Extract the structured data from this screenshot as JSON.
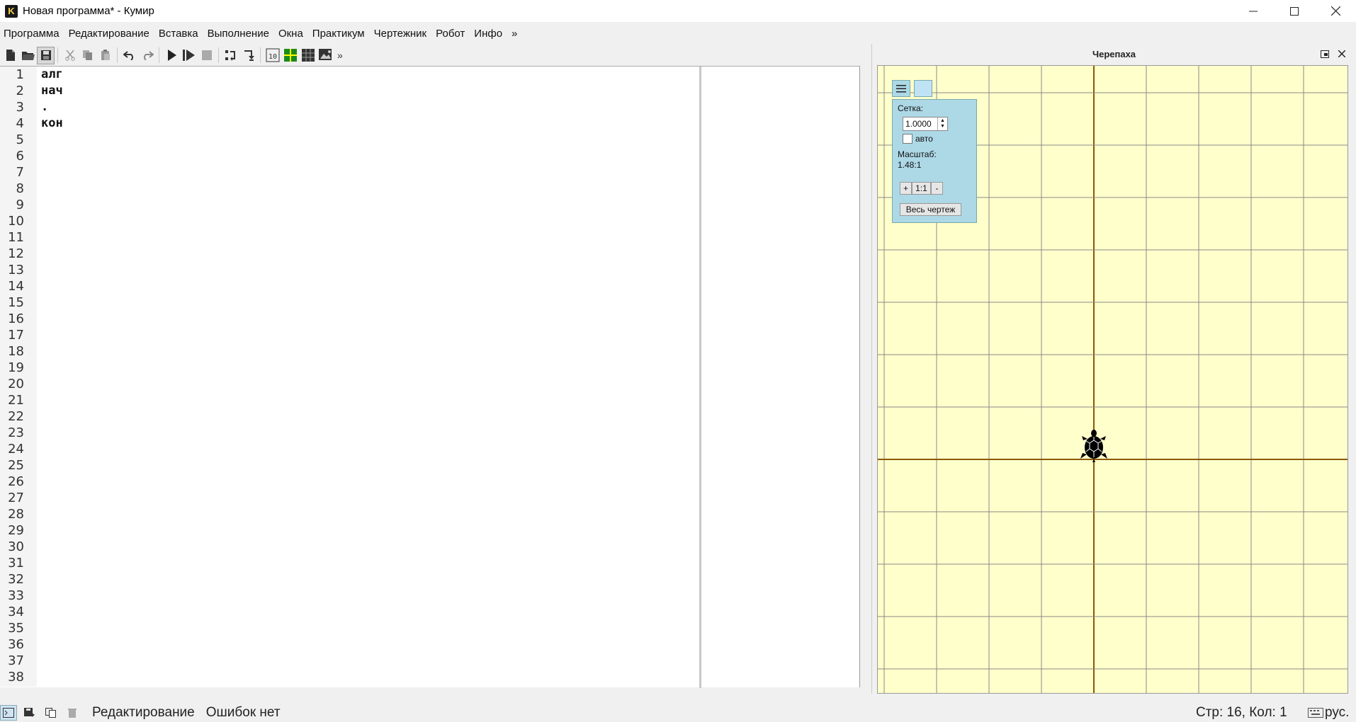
{
  "window": {
    "title": "Новая программа* - Кумир",
    "app_icon_letter": "K",
    "minimize_icon": "minimize-icon",
    "maximize_icon": "maximize-icon",
    "close_icon": "close-icon"
  },
  "menu": {
    "items": [
      "Программа",
      "Редактирование",
      "Вставка",
      "Выполнение",
      "Окна",
      "Практикум",
      "Чертежник",
      "Робот",
      "Инфо"
    ],
    "more": "»"
  },
  "toolbar": {
    "more": "»",
    "buttons": [
      "new-file-icon",
      "open-file-icon",
      "save-icon",
      "cut-icon",
      "copy-icon",
      "paste-icon",
      "undo-icon",
      "redo-icon",
      "run-icon",
      "run-step-icon",
      "stop-icon",
      "step-over-icon",
      "step-into-icon",
      "variables-icon",
      "turtle-grid-icon",
      "robot-field-icon",
      "drawer-icon"
    ]
  },
  "editor": {
    "line_numbers": [
      "1",
      "2",
      "3",
      "4",
      "5",
      "6",
      "7",
      "8",
      "9",
      "10",
      "11",
      "12",
      "13",
      "14",
      "15",
      "16",
      "17",
      "18",
      "19",
      "20",
      "21",
      "22",
      "23",
      "24",
      "25",
      "26",
      "27",
      "28",
      "29",
      "30",
      "31",
      "32",
      "33",
      "34",
      "35",
      "36",
      "37",
      "38"
    ],
    "code_lines": [
      "алг",
      "нач",
      ".",
      "кон"
    ]
  },
  "turtle": {
    "title": "Черепаха",
    "grid_label": "Сетка:",
    "grid_value": "1.0000",
    "auto_label": "авто",
    "auto_checked": false,
    "scale_label": "Масштаб:",
    "scale_value": "1.48:1",
    "zoom_in": "+",
    "zoom_reset": "1:1",
    "zoom_out": "-",
    "fit_all": "Весь чертеж",
    "colors": {
      "canvas": "#ffffcc",
      "grid": "#888888",
      "axis": "#8b5a00",
      "panel": "#add8e6"
    }
  },
  "status": {
    "mode": "Редактирование",
    "errors": "Ошибок нет",
    "position": "Стр: 16, Кол: 1",
    "lang": "рус."
  }
}
